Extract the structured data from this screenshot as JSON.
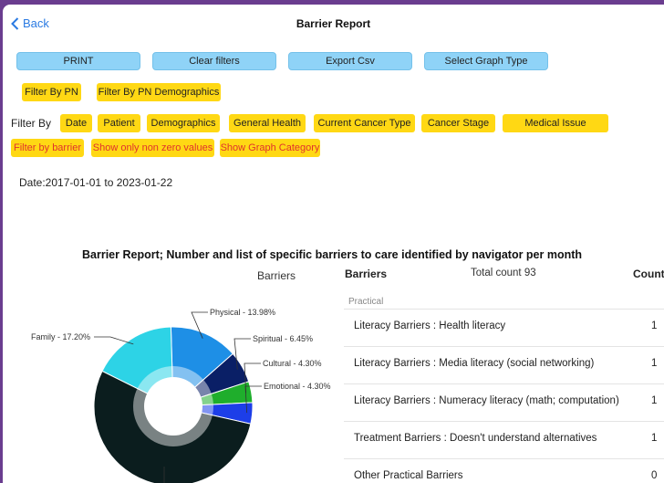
{
  "header": {
    "back_label": "Back",
    "title": "Barrier Report"
  },
  "toolbar": {
    "print": "PRINT",
    "clear_filters": "Clear filters",
    "export_csv": "Export Csv",
    "select_graph": "Select Graph Type"
  },
  "pn_filters": {
    "by_pn": "Filter By PN",
    "by_pn_demo": "Filter By PN Demographics"
  },
  "filter_by": {
    "label": "Filter By",
    "items": [
      "Date",
      "Patient",
      "Demographics",
      "General Health",
      "Current Cancer Type",
      "Cancer Stage",
      "Medical Issue"
    ]
  },
  "extra_filters": [
    "Filter by barrier",
    "Show only non zero values",
    "Show Graph Category"
  ],
  "date_range": "Date:2017-01-01 to 2023-01-22",
  "chart_data": {
    "type": "pie",
    "title": "Barrier Report; Number and list of specific barriers to care identified by navigator per month",
    "subtitle": "Barriers",
    "slices": [
      {
        "label": "Physical - 13.98%",
        "value": 13.98,
        "color": "#1e8fe6"
      },
      {
        "label": "Spiritual - 6.45%",
        "value": 6.45,
        "color": "#0a1f66"
      },
      {
        "label": "Cultural - 4.30%",
        "value": 4.3,
        "color": "#1fae2c"
      },
      {
        "label": "Emotional - 4.30%",
        "value": 4.3,
        "color": "#1d3ee8"
      },
      {
        "label": "",
        "value": 53.77,
        "color": "#0b1d1e"
      },
      {
        "label": "Family - 17.20%",
        "value": 17.2,
        "color": "#2dd3e6"
      }
    ]
  },
  "table": {
    "col_barriers": "Barriers",
    "total": "Total count 93",
    "col_count": "Count",
    "section": "Practical",
    "rows": [
      {
        "name": "Literacy Barriers : Health literacy",
        "count": "1"
      },
      {
        "name": "Literacy Barriers : Media literacy (social networking)",
        "count": "1"
      },
      {
        "name": "Literacy Barriers : Numeracy literacy (math; computation)",
        "count": "1"
      },
      {
        "name": "Treatment Barriers : Doesn't understand alternatives",
        "count": "1"
      },
      {
        "name": "Other Practical Barriers",
        "count": "0"
      }
    ]
  }
}
